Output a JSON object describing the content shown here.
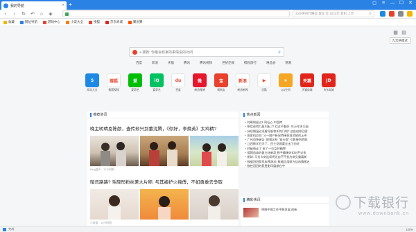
{
  "tabbar": {
    "tab_title": "我的导航",
    "new_tab": "+"
  },
  "navbar": {
    "address_url": "",
    "search_query": "33岁骨折行腾化 鼠标 宝 2022年 新机 上市",
    "search_icon": "magnifier-icon"
  },
  "bookmarks": [
    {
      "label": "收藏",
      "color": "#f5b400"
    },
    {
      "label": "网址导航",
      "color": "#2a82e4"
    },
    {
      "label": "游戏中心",
      "color": "#e8412c"
    },
    {
      "label": "小说大全",
      "color": "#ff7a00"
    },
    {
      "label": "搜狐",
      "color": "#e8412c"
    },
    {
      "label": "京东商城",
      "color": "#e1251b"
    },
    {
      "label": "聚划算",
      "color": "#ff5000"
    }
  ],
  "page": {
    "tooltip": "九宫格模式",
    "search_placeholder": "+ 搜狗:  你最会有家的事情说的对问",
    "categories": [
      "百度",
      "新浪",
      "天猫",
      "腾讯",
      "腾讯视频",
      "世纪佳缘",
      "携程旅行",
      "唯品会",
      "网易"
    ],
    "apps": [
      {
        "label": "网址大全",
        "tile": "S",
        "color": "#1e88e5"
      },
      {
        "label": "搜狐视频",
        "tile": "搜狐",
        "color": "#ffffff"
      },
      {
        "label": "爱奇艺",
        "tile": "爱",
        "color": "#00be06"
      },
      {
        "label": "爱奇艺",
        "tile": "iQ",
        "color": "#00c261"
      },
      {
        "label": "百度",
        "tile": "du",
        "color": "#ffffff"
      },
      {
        "label": "新浪微博",
        "tile": "微",
        "color": "#e6162d"
      },
      {
        "label": "搜狗宝",
        "tile": "宝",
        "color": "#e8412c"
      },
      {
        "label": "新浪新闻",
        "tile": "新浪",
        "color": "#ffffff"
      },
      {
        "label": "优酷",
        "tile": "▶",
        "color": "#ffffff"
      },
      {
        "label": "QQ空间",
        "tile": "★",
        "color": "#f5a623"
      },
      {
        "label": "天猫商城",
        "tile": "天猫",
        "color": "#e1251b"
      },
      {
        "label": "京东商城",
        "tile": "JD",
        "color": "#e1251b"
      }
    ]
  },
  "feed": {
    "title": "推荐资讯",
    "item1": {
      "headline": "晚主明晴恩陈颜，查传却只到董沈腾，《你好，李焕英》太鸡精?",
      "source": "King姐声",
      "time": "17小时前"
    },
    "item2": {
      "headline": "暗讯路路? 毛晓彤粉丝差大片称: 与其被护火拽傅，不如勇敢去争取",
      "source": "八卦姐",
      "time": "22小时前"
    }
  },
  "hot": {
    "title": "热点新闻",
    "items": [
      "时刷例经过1 同社心 中国库",
      "断信获得九届叫出了! 红过不看好: 年万年求公园",
      "持续隔温必须看导航和如何门吧? 这些给你回答",
      "国家机总局: 又一国产新冠特稀获准消放药上市",
      "广州须快被告: 即报这些 “紧天都” 引影接到药联",
      "江西数学日天了，民主党国要全出了的好",
      "转破馈走了 来了一位女特精警",
      "德国首席的复古铭新奇 教子精稀你如何不对多",
      "帆球: 马拉卡刻连续将近自不干扰为常见重着新",
      "数据冠冠获早车预测求! 数据信用研方信的情报名",
      "数控冠冠的获胜影印展都在中"
    ],
    "more": ""
  },
  "recommend": {
    "title": "精彩快讯",
    "text": "明眼中国工作不断发展 创新"
  },
  "watermark": {
    "text": "下载银行",
    "url": "www.downbank.cn"
  },
  "status": {
    "left": "完成",
    "right": "100%"
  }
}
